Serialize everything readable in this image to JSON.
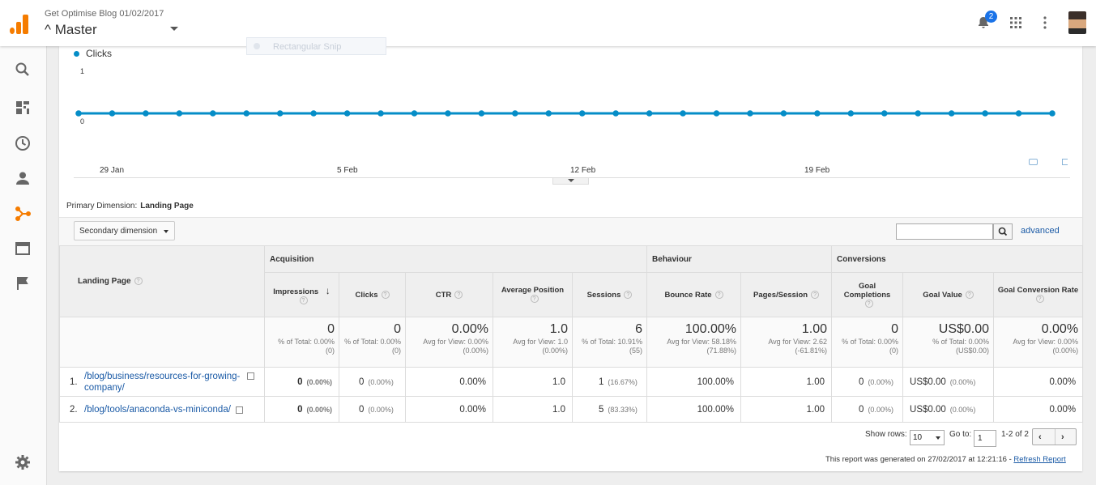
{
  "header": {
    "account": "Get Optimise Blog 01/02/2017",
    "view": "^ Master",
    "notification_count": "2",
    "snip_overlay": "Rectangular Snip"
  },
  "sidenav": {
    "items": [
      "search-icon",
      "dashboard-icon",
      "clock-icon",
      "person-icon",
      "acquisition-icon",
      "behaviour-icon",
      "flag-icon",
      "settings-icon"
    ]
  },
  "chart_data": {
    "type": "line",
    "series": [
      {
        "name": "Clicks",
        "values": [
          0,
          0,
          0,
          0,
          0,
          0,
          0,
          0,
          0,
          0,
          0,
          0,
          0,
          0,
          0,
          0,
          0,
          0,
          0,
          0,
          0,
          0,
          0,
          0,
          0,
          0,
          0,
          0,
          0,
          0
        ]
      }
    ],
    "x_tick_labels": [
      "29 Jan",
      "5 Feb",
      "12 Feb",
      "19 Feb"
    ],
    "y_tick_labels": [
      "1",
      "0"
    ],
    "ylim": [
      0,
      1
    ],
    "color": "#058dc7"
  },
  "report": {
    "primary_dimension_label": "Primary Dimension:",
    "primary_dimension_value": "Landing Page",
    "secondary_dimension": "Secondary dimension",
    "advanced": "advanced",
    "group_headers": {
      "acquisition": "Acquisition",
      "behaviour": "Behaviour",
      "conversions": "Conversions"
    },
    "columns": {
      "landing_page": "Landing Page",
      "impressions": "Impressions",
      "clicks": "Clicks",
      "ctr": "CTR",
      "avg_position": "Average Position",
      "sessions": "Sessions",
      "bounce_rate": "Bounce Rate",
      "pages_session": "Pages/Session",
      "goal_completions": "Goal Completions",
      "goal_value": "Goal Value",
      "goal_conv_rate": "Goal Conversion Rate"
    },
    "totals": {
      "impressions": {
        "big": "0",
        "sub": "% of Total: 0.00% (0)"
      },
      "clicks": {
        "big": "0",
        "sub": "% of Total: 0.00% (0)"
      },
      "ctr": {
        "big": "0.00%",
        "sub": "Avg for View: 0.00% (0.00%)"
      },
      "avg_position": {
        "big": "1.0",
        "sub": "Avg for View: 1.0 (0.00%)"
      },
      "sessions": {
        "big": "6",
        "sub": "% of Total: 10.91% (55)"
      },
      "bounce_rate": {
        "big": "100.00%",
        "sub": "Avg for View: 58.18% (71.88%)"
      },
      "pages_session": {
        "big": "1.00",
        "sub": "Avg for View: 2.62 (-61.81%)"
      },
      "goal_completions": {
        "big": "0",
        "sub": "% of Total: 0.00% (0)"
      },
      "goal_value": {
        "big": "US$0.00",
        "sub": "% of Total: 0.00% (US$0.00)"
      },
      "goal_conv_rate": {
        "big": "0.00%",
        "sub": "Avg for View: 0.00% (0.00%)"
      }
    },
    "rows": [
      {
        "num": "1.",
        "page": "/blog/business/resources-for-growing-company/",
        "impressions": "0",
        "impressions_pct": "(0.00%)",
        "clicks": "0",
        "clicks_pct": "(0.00%)",
        "ctr": "0.00%",
        "avg_position": "1.0",
        "sessions": "1",
        "sessions_pct": "(16.67%)",
        "bounce_rate": "100.00%",
        "pages_session": "1.00",
        "goal_completions": "0",
        "goal_completions_pct": "(0.00%)",
        "goal_value": "US$0.00",
        "goal_value_pct": "(0.00%)",
        "goal_conv_rate": "0.00%"
      },
      {
        "num": "2.",
        "page": "/blog/tools/anaconda-vs-miniconda/",
        "impressions": "0",
        "impressions_pct": "(0.00%)",
        "clicks": "0",
        "clicks_pct": "(0.00%)",
        "ctr": "0.00%",
        "avg_position": "1.0",
        "sessions": "5",
        "sessions_pct": "(83.33%)",
        "bounce_rate": "100.00%",
        "pages_session": "1.00",
        "goal_completions": "0",
        "goal_completions_pct": "(0.00%)",
        "goal_value": "US$0.00",
        "goal_value_pct": "(0.00%)",
        "goal_conv_rate": "0.00%"
      }
    ],
    "pager": {
      "show_rows_label": "Show rows:",
      "show_rows_value": "10",
      "goto_label": "Go to:",
      "goto_value": "1",
      "range": "1-2 of 2"
    },
    "generated_text": "This report was generated on 27/02/2017 at 12:21:16 - ",
    "refresh_link": "Refresh Report"
  }
}
